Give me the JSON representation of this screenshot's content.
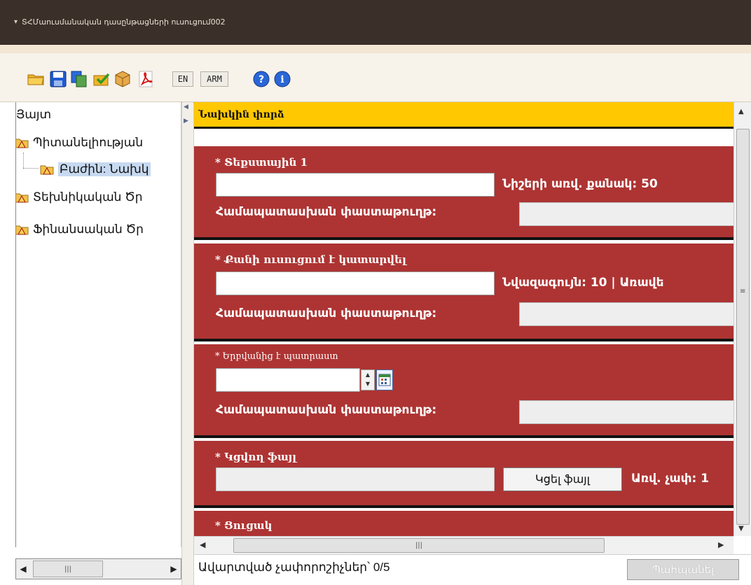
{
  "window": {
    "title": "ՏՀՄաուսմանական դասընթացների ուսուցում002"
  },
  "toolbar": {
    "icons": [
      "open-folder-icon",
      "save-icon",
      "copy-icon",
      "approve-icon",
      "package-icon",
      "pdf-icon",
      "help-icon",
      "info-icon"
    ],
    "lang_en": "EN",
    "lang_arm": "ARM"
  },
  "tree": {
    "items": [
      {
        "label": "Յայտ",
        "level": 0
      },
      {
        "label": "Պիտանելիության",
        "level": 1
      },
      {
        "label": "Բաժին: Նախկ",
        "level": 2,
        "selected": true
      },
      {
        "label": "Տեխնիկական Ծր",
        "level": 1
      },
      {
        "label": "Ֆինանսական Ծր",
        "level": 1
      }
    ]
  },
  "form": {
    "header": "Նախկին փորձ",
    "sections": [
      {
        "label": "* Տեքստային 1",
        "hint": "Նիշերի առվ. քանակ: 50",
        "proof_label": "Համապատասխան փաստաթուղթ:"
      },
      {
        "label": "* Քանի ուսուցում է կատարվել",
        "hint": "Նվազագույն: 10 | Առավե",
        "proof_label": "Համապատասխան փաստաթուղթ:"
      },
      {
        "label": "* Երբվանից է պատրաստ",
        "proof_label": "Համապատասխան փաստաթուղթ:"
      },
      {
        "label": "* Կցվող ֆայլ",
        "button": "Կցել ֆայլ",
        "hint": "Առվ. չափ: 1"
      },
      {
        "label": "* Ցուցակ"
      }
    ]
  },
  "status": {
    "text": "Ավարտված չափորոշիչներ՝ 0/5",
    "save_button": "Պահպանել"
  },
  "colors": {
    "titlebar": "#3b3029",
    "header_yellow": "#ffc800",
    "section_red": "#ad3433"
  }
}
